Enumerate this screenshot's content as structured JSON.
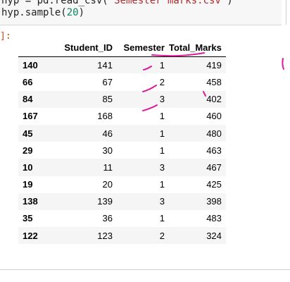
{
  "code": {
    "line1_a": "hyp = pd.read_csv(",
    "line1_str": "'Semester marks.csv'",
    "line1_b": ")",
    "line2_a": "hyp.sample(",
    "line2_num": "20",
    "line2_b": ")"
  },
  "output": {
    "prompt": "]:",
    "columns": [
      "",
      "Student_ID",
      "Semester",
      "Total_Marks"
    ],
    "rows": [
      {
        "index": "140",
        "student_id": "141",
        "semester": "1",
        "total_marks": "419"
      },
      {
        "index": "66",
        "student_id": "67",
        "semester": "2",
        "total_marks": "458"
      },
      {
        "index": "84",
        "student_id": "85",
        "semester": "3",
        "total_marks": "402"
      },
      {
        "index": "167",
        "student_id": "168",
        "semester": "1",
        "total_marks": "460"
      },
      {
        "index": "45",
        "student_id": "46",
        "semester": "1",
        "total_marks": "480"
      },
      {
        "index": "29",
        "student_id": "30",
        "semester": "1",
        "total_marks": "463"
      },
      {
        "index": "10",
        "student_id": "11",
        "semester": "3",
        "total_marks": "467"
      },
      {
        "index": "19",
        "student_id": "20",
        "semester": "1",
        "total_marks": "425"
      },
      {
        "index": "138",
        "student_id": "139",
        "semester": "3",
        "total_marks": "398"
      },
      {
        "index": "35",
        "student_id": "36",
        "semester": "1",
        "total_marks": "483"
      },
      {
        "index": "122",
        "student_id": "123",
        "semester": "2",
        "total_marks": "324"
      }
    ]
  },
  "colors": {
    "annotation": "#e0199b",
    "string": "#b02a2a",
    "number": "#098658"
  }
}
